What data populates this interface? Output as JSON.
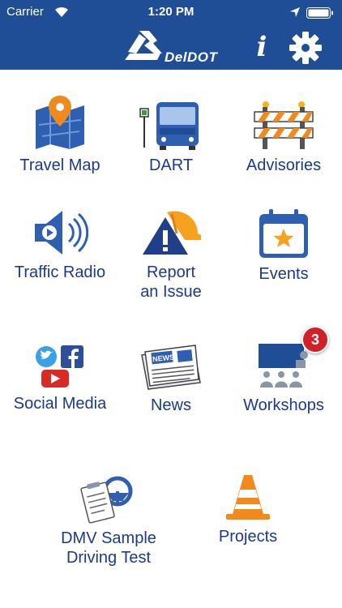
{
  "status_bar": {
    "carrier": "Carrier",
    "time": "1:20 PM"
  },
  "header": {
    "app_name": "DelDOT",
    "info_glyph": "i"
  },
  "tiles": [
    {
      "label": "Travel Map",
      "icon": "map-pin-icon"
    },
    {
      "label": "DART",
      "icon": "bus-icon"
    },
    {
      "label": "Advisories",
      "icon": "barricade-icon"
    },
    {
      "label": "Traffic Radio",
      "icon": "speaker-icon"
    },
    {
      "label": "Report\nan Issue",
      "icon": "warning-icon"
    },
    {
      "label": "Events",
      "icon": "calendar-star-icon"
    },
    {
      "label": "Social Media",
      "icon": "social-icons"
    },
    {
      "label": "News",
      "icon": "newspaper-icon"
    },
    {
      "label": "Workshops",
      "icon": "presentation-icon",
      "badge": "3"
    },
    {
      "label": "DMV Sample\nDriving Test",
      "icon": "driving-test-icon"
    },
    {
      "label": "Projects",
      "icon": "traffic-cone-icon"
    }
  ],
  "colors": {
    "header_blue": "#1f4e96",
    "label_blue": "#1a3a8a",
    "orange": "#f08a1c",
    "badge_red": "#d0202a"
  }
}
